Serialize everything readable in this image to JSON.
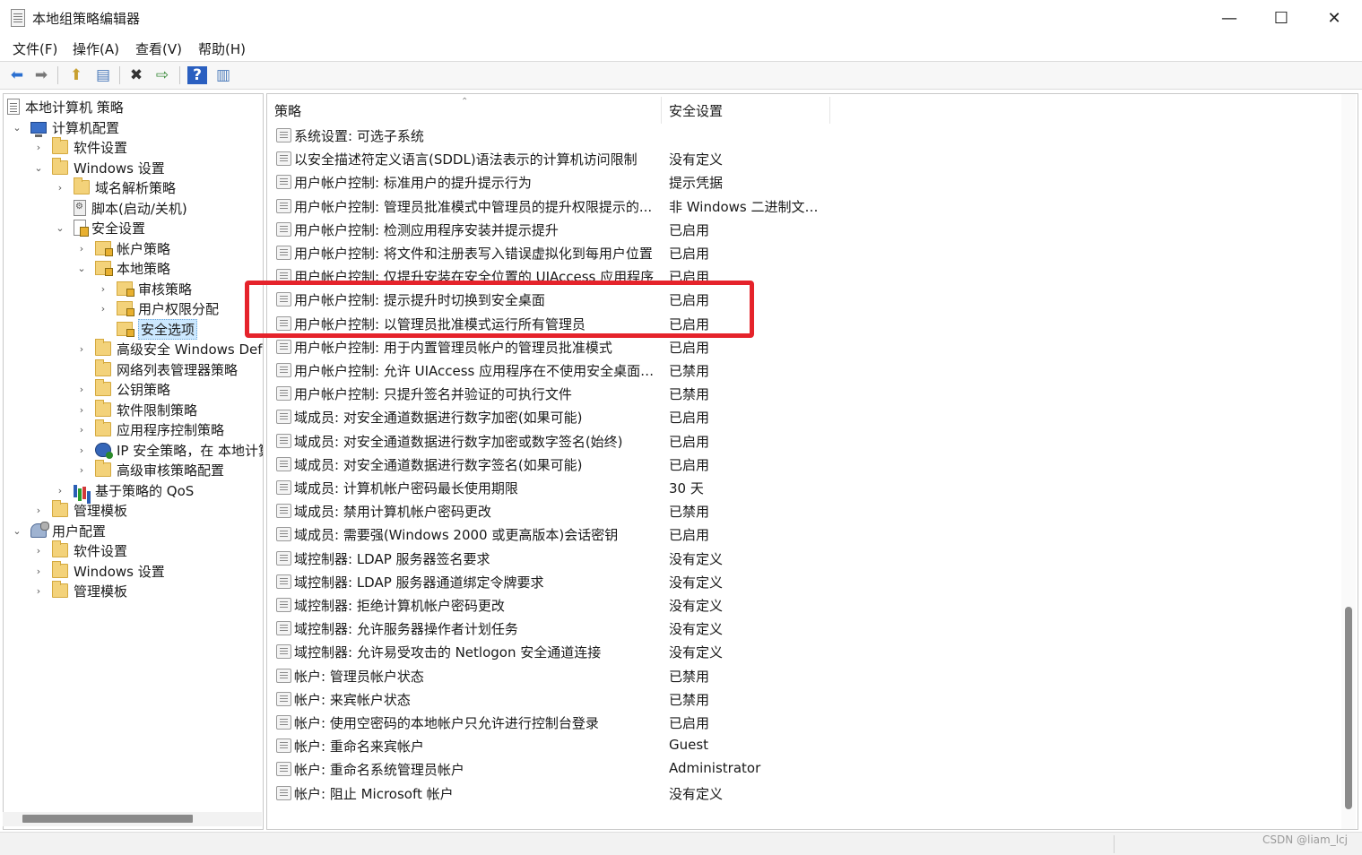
{
  "window": {
    "title": "本地组策略编辑器",
    "minimize_glyph": "—",
    "maximize_glyph": "☐",
    "close_glyph": "✕"
  },
  "menu": [
    {
      "label": "文件(F)"
    },
    {
      "label": "操作(A)"
    },
    {
      "label": "查看(V)"
    },
    {
      "label": "帮助(H)"
    }
  ],
  "toolbar": {
    "icons": [
      "back-arrow-icon",
      "forward-arrow-icon",
      "up-folder-icon",
      "show-hide-tree-icon",
      "delete-icon",
      "export-list-icon",
      "help-icon",
      "properties-pane-icon"
    ],
    "glyphs": {
      "back": "⬅",
      "forward": "➡",
      "up": "⬆",
      "tree": "▤",
      "delete": "✖",
      "export": "⇨",
      "help": "?",
      "pane": "▥"
    }
  },
  "tree": [
    {
      "label": "本地计算机 策略",
      "icon": "policy",
      "chevron": ""
    },
    {
      "label": "计算机配置",
      "icon": "computer",
      "chevron": "⌄"
    },
    {
      "label": "软件设置",
      "icon": "folder",
      "chevron": "›"
    },
    {
      "label": "Windows 设置",
      "icon": "folder",
      "chevron": "⌄"
    },
    {
      "label": "域名解析策略",
      "icon": "folder",
      "chevron": "›"
    },
    {
      "label": "脚本(启动/关机)",
      "icon": "script",
      "chevron": ""
    },
    {
      "label": "安全设置",
      "icon": "shield",
      "chevron": "⌄"
    },
    {
      "label": "帐户策略",
      "icon": "lockfolder",
      "chevron": "›"
    },
    {
      "label": "本地策略",
      "icon": "lockfolder",
      "chevron": "⌄"
    },
    {
      "label": "审核策略",
      "icon": "lockfolder",
      "chevron": "›"
    },
    {
      "label": "用户权限分配",
      "icon": "lockfolder",
      "chevron": "›"
    },
    {
      "label": "安全选项",
      "icon": "lockfolder",
      "chevron": "",
      "selected": true
    },
    {
      "label": "高级安全 Windows Defe",
      "icon": "folder",
      "chevron": "›"
    },
    {
      "label": "网络列表管理器策略",
      "icon": "folder",
      "chevron": ""
    },
    {
      "label": "公钥策略",
      "icon": "folder",
      "chevron": "›"
    },
    {
      "label": "软件限制策略",
      "icon": "folder",
      "chevron": "›"
    },
    {
      "label": "应用程序控制策略",
      "icon": "folder",
      "chevron": "›"
    },
    {
      "label": "IP 安全策略，在 本地计算",
      "icon": "network",
      "chevron": "›"
    },
    {
      "label": "高级审核策略配置",
      "icon": "folder",
      "chevron": "›"
    },
    {
      "label": "基于策略的 QoS",
      "icon": "chart",
      "chevron": "›"
    },
    {
      "label": "管理模板",
      "icon": "folder",
      "chevron": "›"
    },
    {
      "label": "用户配置",
      "icon": "user",
      "chevron": "⌄"
    },
    {
      "label": "软件设置",
      "icon": "folder",
      "chevron": "›"
    },
    {
      "label": "Windows 设置",
      "icon": "folder",
      "chevron": "›"
    },
    {
      "label": "管理模板",
      "icon": "folder",
      "chevron": "›"
    }
  ],
  "list": {
    "col_policy": "策略",
    "col_setting": "安全设置",
    "sort_glyph": "⌃",
    "rows": [
      {
        "name": "系统设置: 可选子系统",
        "value": ""
      },
      {
        "name": "以安全描述符定义语言(SDDL)语法表示的计算机访问限制",
        "value": "没有定义"
      },
      {
        "name": "用户帐户控制: 标准用户的提升提示行为",
        "value": "提示凭据"
      },
      {
        "name": "用户帐户控制: 管理员批准模式中管理员的提升权限提示的...",
        "value": "非 Windows 二进制文件..."
      },
      {
        "name": "用户帐户控制: 检测应用程序安装并提示提升",
        "value": "已启用"
      },
      {
        "name": "用户帐户控制: 将文件和注册表写入错误虚拟化到每用户位置",
        "value": "已启用"
      },
      {
        "name": "用户帐户控制: 仅提升安装在安全位置的 UIAccess 应用程序",
        "value": "已启用"
      },
      {
        "name": "用户帐户控制: 提示提升时切换到安全桌面",
        "value": "已启用"
      },
      {
        "name": "用户帐户控制: 以管理员批准模式运行所有管理员",
        "value": "已启用"
      },
      {
        "name": "用户帐户控制: 用于内置管理员帐户的管理员批准模式",
        "value": "已启用"
      },
      {
        "name": "用户帐户控制: 允许 UIAccess 应用程序在不使用安全桌面的...",
        "value": "已禁用"
      },
      {
        "name": "用户帐户控制: 只提升签名并验证的可执行文件",
        "value": "已禁用"
      },
      {
        "name": "域成员: 对安全通道数据进行数字加密(如果可能)",
        "value": "已启用"
      },
      {
        "name": "域成员: 对安全通道数据进行数字加密或数字签名(始终)",
        "value": "已启用"
      },
      {
        "name": "域成员: 对安全通道数据进行数字签名(如果可能)",
        "value": "已启用"
      },
      {
        "name": "域成员: 计算机帐户密码最长使用期限",
        "value": "30 天"
      },
      {
        "name": "域成员: 禁用计算机帐户密码更改",
        "value": "已禁用"
      },
      {
        "name": "域成员: 需要强(Windows 2000 或更高版本)会话密钥",
        "value": "已启用"
      },
      {
        "name": "域控制器: LDAP 服务器签名要求",
        "value": "没有定义"
      },
      {
        "name": "域控制器: LDAP 服务器通道绑定令牌要求",
        "value": "没有定义"
      },
      {
        "name": "域控制器: 拒绝计算机帐户密码更改",
        "value": "没有定义"
      },
      {
        "name": "域控制器: 允许服务器操作者计划任务",
        "value": "没有定义"
      },
      {
        "name": "域控制器: 允许易受攻击的 Netlogon 安全通道连接",
        "value": "没有定义"
      },
      {
        "name": "帐户: 管理员帐户状态",
        "value": "已禁用"
      },
      {
        "name": "帐户: 来宾帐户状态",
        "value": "已禁用"
      },
      {
        "name": "帐户: 使用空密码的本地帐户只允许进行控制台登录",
        "value": "已启用"
      },
      {
        "name": "帐户: 重命名来宾帐户",
        "value": "Guest"
      },
      {
        "name": "帐户: 重命名系统管理员帐户",
        "value": "Administrator"
      },
      {
        "name": "帐户: 阻止 Microsoft 帐户",
        "value": "没有定义"
      }
    ]
  },
  "annotation": {
    "color": "#e5232b"
  },
  "watermark": "CSDN @liam_lcj"
}
